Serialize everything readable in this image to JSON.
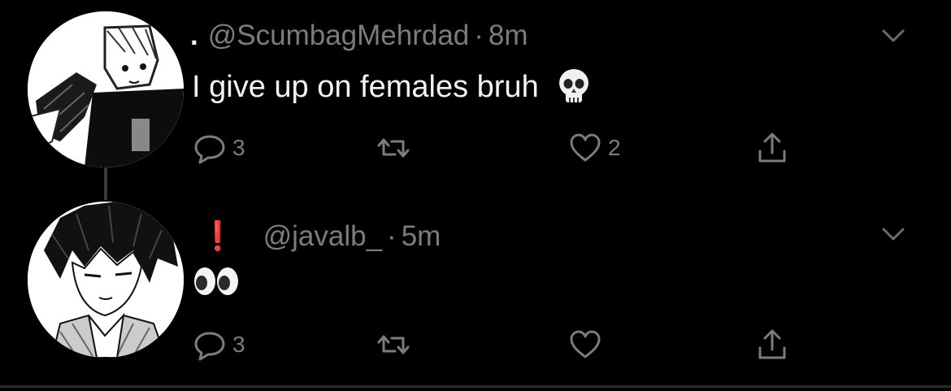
{
  "tweets": [
    {
      "name_mark": ".",
      "handle": "@ScumbagMehrdad",
      "separator": "·",
      "time": "8m",
      "text": "I give up on females bruh",
      "emoji": "skull",
      "reply_count": "3",
      "retweet_count": "",
      "like_count": "2"
    },
    {
      "name_mark": "❗",
      "handle": "@javalb_",
      "separator": "·",
      "time": "5m",
      "text": "",
      "emoji": "eyes",
      "reply_count": "3",
      "retweet_count": "",
      "like_count": ""
    }
  ],
  "colors": {
    "background": "#000000",
    "muted": "#7c7c7c",
    "text": "#f2f2f2",
    "exclamation": "#e0141e"
  },
  "icons": [
    "reply-icon",
    "retweet-icon",
    "like-icon",
    "share-icon",
    "chevron-down-icon"
  ]
}
